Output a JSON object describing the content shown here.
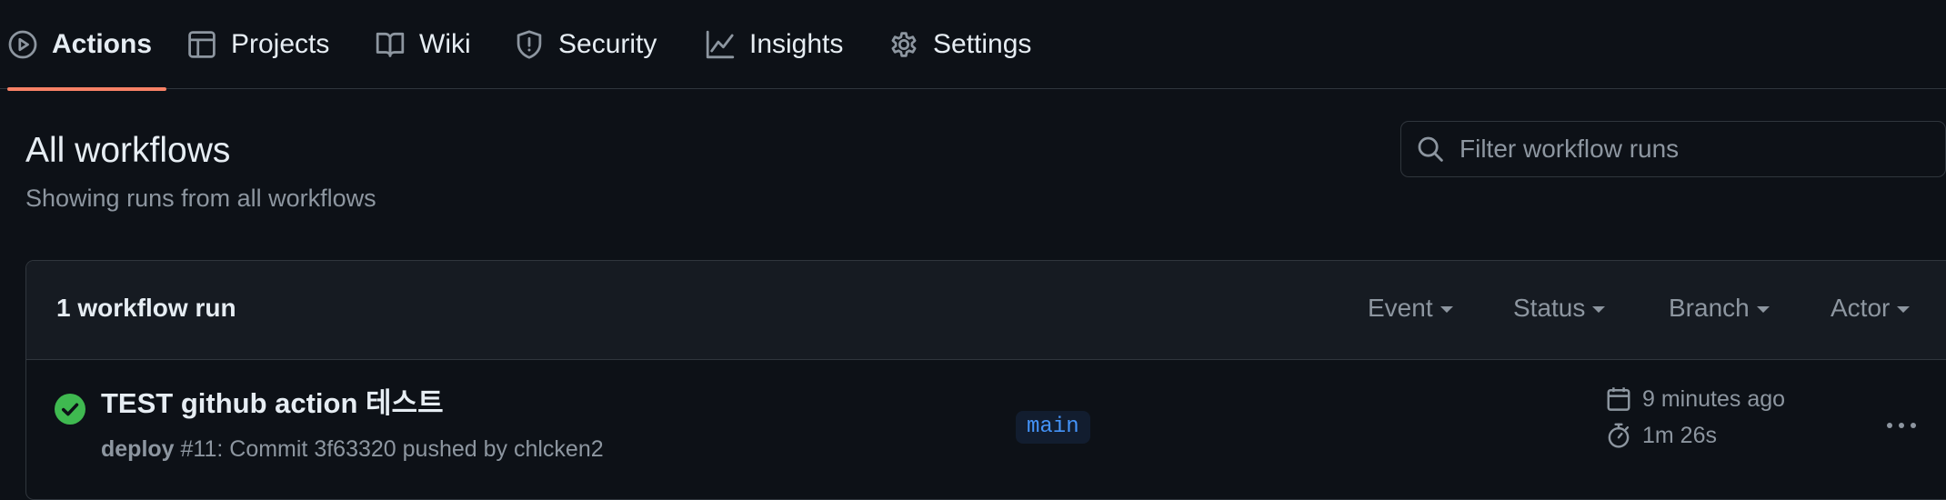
{
  "nav": {
    "tabs": [
      {
        "label": "Actions",
        "icon": "play-circle-icon",
        "active": true
      },
      {
        "label": "Projects",
        "icon": "table-icon"
      },
      {
        "label": "Wiki",
        "icon": "book-icon"
      },
      {
        "label": "Security",
        "icon": "shield-icon"
      },
      {
        "label": "Insights",
        "icon": "graph-icon"
      },
      {
        "label": "Settings",
        "icon": "gear-icon"
      }
    ]
  },
  "header": {
    "title": "All workflows",
    "subtitle": "Showing runs from all workflows",
    "search": {
      "placeholder": "Filter workflow runs",
      "value": "",
      "icon": "search-icon"
    }
  },
  "runs": {
    "count_label": "1 workflow run",
    "filters": [
      "Event",
      "Status",
      "Branch",
      "Actor"
    ],
    "items": [
      {
        "status": "success",
        "status_icon": "check-circle-icon",
        "title": "TEST github action 테스트",
        "workflow": "deploy",
        "description": " #11: Commit 3f63320 pushed by chlcken2",
        "branch": "main",
        "time_ago": "9 minutes ago",
        "duration": "1m 26s"
      }
    ]
  },
  "colors": {
    "background": "#0d1117",
    "header_bg": "#161b22",
    "border": "#30363d",
    "active_underline": "#f78166",
    "success": "#3fb950",
    "branch_text": "#4493f8",
    "branch_bg": "#121d2f",
    "muted_text": "#8d96a0"
  }
}
